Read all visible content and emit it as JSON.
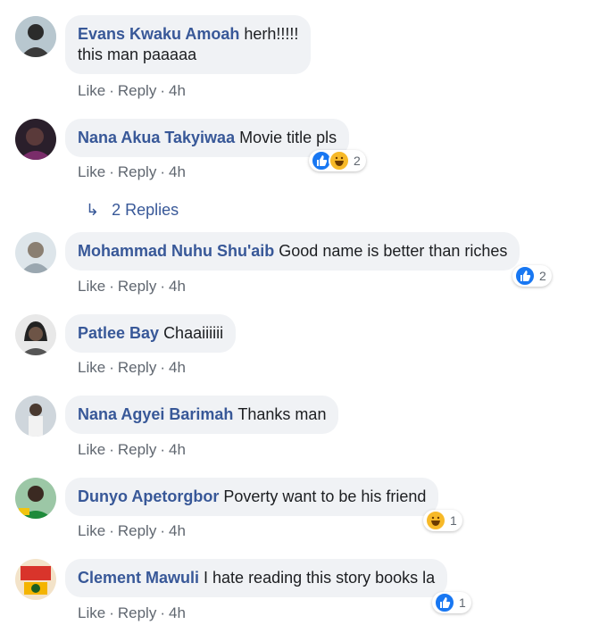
{
  "actions": {
    "like": "Like",
    "reply": "Reply",
    "sep": "·"
  },
  "comments": [
    {
      "author": "Evans Kwaku Amoah",
      "text_line1": "herh!!!!!",
      "text_line2": "this man paaaaa",
      "time": "4h"
    },
    {
      "author": "Nana Akua Takyiwaa",
      "text": "Movie title pls",
      "time": "4h",
      "reaction_count": "2",
      "reactions": [
        "like-icon",
        "haha-icon"
      ]
    },
    {
      "author": "Mohammad Nuhu Shu'aib",
      "text": "Good name is better than riches",
      "time": "4h",
      "reaction_count": "2",
      "reactions": [
        "like-icon"
      ]
    },
    {
      "author": "Patlee Bay",
      "text": "Chaaiiiiii",
      "time": "4h"
    },
    {
      "author": "Nana Agyei Barimah",
      "text": "Thanks man",
      "time": "4h"
    },
    {
      "author": "Dunyo Apetorgbor",
      "text": "Poverty want to be his friend",
      "time": "4h",
      "reaction_count": "1",
      "reactions": [
        "haha-icon"
      ]
    },
    {
      "author": "Clement Mawuli",
      "text": "I hate reading this story books la",
      "time": "4h",
      "reaction_count": "1",
      "reactions": [
        "like-icon"
      ]
    }
  ],
  "replies_link": "2 Replies",
  "colors": {
    "link": "#385898",
    "bubble": "#f0f2f5",
    "meta": "#606770",
    "like": "#1877f2",
    "haha": "#f7b928"
  }
}
